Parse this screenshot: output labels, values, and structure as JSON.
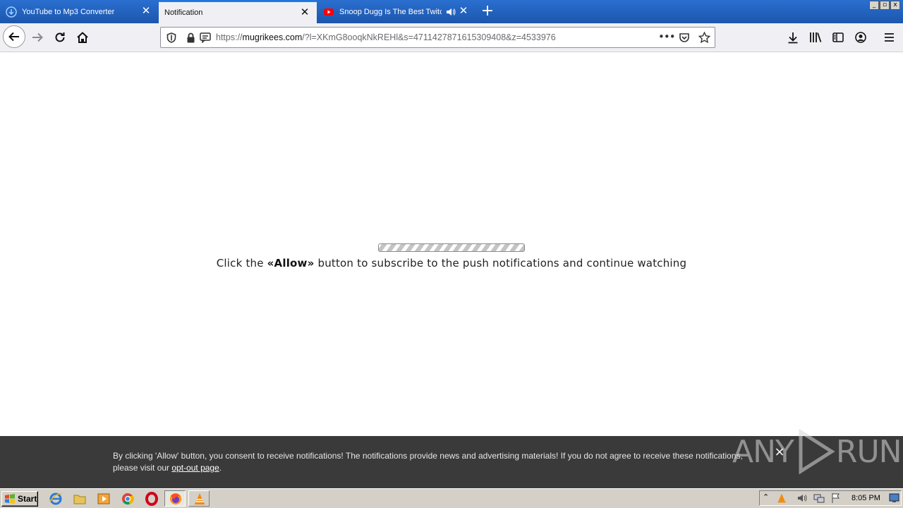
{
  "browser": {
    "tabs": [
      {
        "label": "YouTube to Mp3 Converter",
        "active": false
      },
      {
        "label": "Notification",
        "active": true
      },
      {
        "label": "Snoop Dugg Is The Best Twitch",
        "active": false,
        "playing_audio": true
      }
    ],
    "url_prefix": "https://",
    "url_domain": "mugrikees.com",
    "url_path": "/?l=XKmG8ooqkNkREHl&s=4711427871615309408&z=4533976"
  },
  "page": {
    "message_before": "Click the ",
    "message_bold": "«Allow»",
    "message_after": " button to subscribe to the push notifications and continue watching"
  },
  "notice": {
    "text": "By clicking 'Allow' button, you consent to receive notifications! The notifications provide news and advertising materials! If you do not agree to receive these notifications, please visit our ",
    "link": "opt-out page",
    "end": ".",
    "close": "×"
  },
  "watermark": {
    "text_left": "ANY",
    "text_right": "RUN"
  },
  "taskbar": {
    "start_label": "Start",
    "clock": "8:05 PM"
  },
  "colors": {
    "tabstrip": "#1c56ad",
    "accent": "#0a84ff",
    "notice_bg": "#3a3a3a",
    "taskbar": "#d4d0c8"
  }
}
